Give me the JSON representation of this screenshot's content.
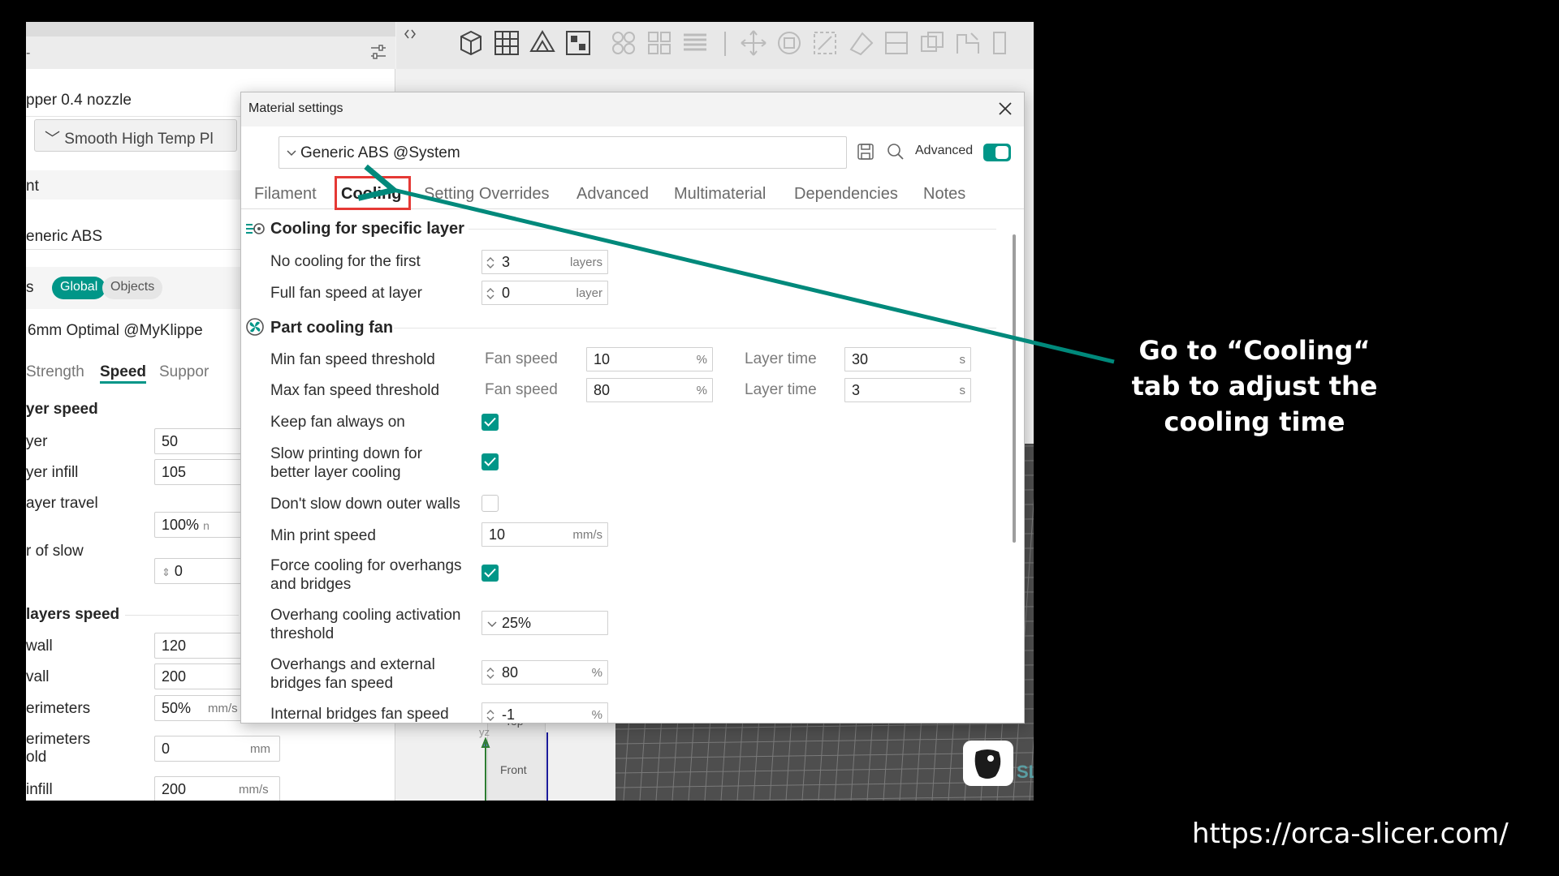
{
  "left_panel": {
    "printer": "pper 0.4 nozzle",
    "plate": "Smooth High Temp Pl",
    "filament_header": "nt",
    "filament": "eneric ABS",
    "process_prefix": "s",
    "global_label": "Global",
    "objects_label": "Objects",
    "process_preset": "6mm Optimal @MyKlippe",
    "subtabs": [
      "Strength",
      "Speed",
      "Suppor"
    ],
    "first_layer_speed_header": "yer speed",
    "rows": [
      {
        "label": "yer",
        "value": "50",
        "unit": ""
      },
      {
        "label": "yer infill",
        "value": "105",
        "unit": ""
      },
      {
        "label": "ayer travel",
        "value": "100%",
        "unit": "n"
      },
      {
        "label": "r of slow",
        "value": "0",
        "unit": ""
      }
    ],
    "other_layers_header": "layers speed",
    "rows2": [
      {
        "label": "wall",
        "value": "120",
        "unit": ""
      },
      {
        "label": "vall",
        "value": "200",
        "unit": ""
      },
      {
        "label": "erimeters",
        "value": "50%",
        "unit": "mm/s or %"
      },
      {
        "label": "erimeters",
        "label2": "old",
        "value": "0",
        "unit": "mm"
      },
      {
        "label": "infill",
        "value": "200",
        "unit": "mm/s"
      }
    ]
  },
  "viewport": {
    "cube_top": "Top",
    "cube_front": "Front",
    "axis_label": "yz",
    "logo_text": "SL"
  },
  "dialog": {
    "title": "Material settings",
    "preset": "Generic ABS @System",
    "advanced_label": "Advanced",
    "tabs": [
      "Filament",
      "Cooling",
      "Setting Overrides",
      "Advanced",
      "Multimaterial",
      "Dependencies",
      "Notes"
    ],
    "active_tab": "Cooling",
    "section1": {
      "title": "Cooling for specific layer",
      "rows": [
        {
          "label": "No cooling for the first",
          "value": "3",
          "unit": "layers"
        },
        {
          "label": "Full fan speed at layer",
          "value": "0",
          "unit": "layer"
        }
      ]
    },
    "section2": {
      "title": "Part cooling fan",
      "min_threshold": {
        "label": "Min fan speed threshold",
        "fan_label": "Fan speed",
        "fan_value": "10",
        "fan_unit": "%",
        "time_label": "Layer time",
        "time_value": "30",
        "time_unit": "s"
      },
      "max_threshold": {
        "label": "Max fan speed threshold",
        "fan_label": "Fan speed",
        "fan_value": "80",
        "fan_unit": "%",
        "time_label": "Layer time",
        "time_value": "3",
        "time_unit": "s"
      },
      "keep_fan_on": {
        "label": "Keep fan always on",
        "checked": true
      },
      "slow_down": {
        "label1": "Slow printing down for",
        "label2": "better layer cooling",
        "checked": true
      },
      "dont_slow_outer": {
        "label": "Don't slow down outer walls",
        "checked": false
      },
      "min_print_speed": {
        "label": "Min print speed",
        "value": "10",
        "unit": "mm/s"
      },
      "force_cooling": {
        "label1": "Force cooling for overhangs",
        "label2": "and bridges",
        "checked": true
      },
      "overhang_threshold": {
        "label1": "Overhang cooling activation",
        "label2": "threshold",
        "value": "25%"
      },
      "overhang_fan": {
        "label1": "Overhangs and external",
        "label2": "bridges fan speed",
        "value": "80",
        "unit": "%"
      },
      "internal_bridges": {
        "label": "Internal bridges fan speed",
        "value": "-1",
        "unit": "%"
      }
    }
  },
  "annotation": {
    "caption_line1": "Go to “Cooling“",
    "caption_line2": "tab to adjust the",
    "caption_line3": "cooling time",
    "arrow_color": "#00897b",
    "highlight_color": "#e53935",
    "url": "https://orca-slicer.com/"
  },
  "colors": {
    "accent": "#009688",
    "background": "#000000"
  }
}
